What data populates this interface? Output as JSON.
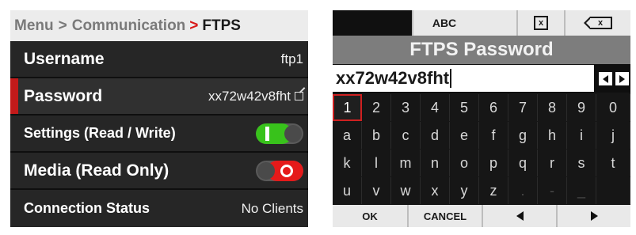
{
  "menu": {
    "breadcrumb": {
      "root": "Menu",
      "sep1": ">",
      "parent": "Communication",
      "sep2": ">",
      "current": "FTPS"
    },
    "rows": {
      "username": {
        "label": "Username",
        "value": "ftp1"
      },
      "password": {
        "label": "Password",
        "value": "xx72w42v8fht",
        "icon": "edit-icon"
      },
      "settings": {
        "label": "Settings (Read / Write)",
        "toggle": "on"
      },
      "media": {
        "label": "Media (Read Only)",
        "toggle": "off"
      },
      "status": {
        "label": "Connection Status",
        "value": "No Clients"
      }
    }
  },
  "keyboard": {
    "topbar": {
      "mode_label": "ABC",
      "clear_icon": "x-box-icon",
      "clear_text": "x",
      "backspace_icon": "backspace-icon",
      "backspace_text": "x"
    },
    "title": "FTPS Password",
    "entry": {
      "value": "xx72w42v8fht"
    },
    "rows": [
      [
        "1",
        "2",
        "3",
        "4",
        "5",
        "6",
        "7",
        "8",
        "9",
        "0"
      ],
      [
        "a",
        "b",
        "c",
        "d",
        "e",
        "f",
        "g",
        "h",
        "i",
        "j"
      ],
      [
        "k",
        "l",
        "m",
        "n",
        "o",
        "p",
        "q",
        "r",
        "s",
        "t"
      ],
      [
        "u",
        "v",
        "w",
        "x",
        "y",
        "z",
        ".",
        "-",
        "_",
        ""
      ]
    ],
    "selected_key": "1",
    "bottombar": {
      "ok": "OK",
      "cancel": "CANCEL"
    }
  },
  "colors": {
    "accent_red": "#d81818",
    "toggle_on": "#38c21b",
    "toggle_off": "#e51a1a"
  }
}
